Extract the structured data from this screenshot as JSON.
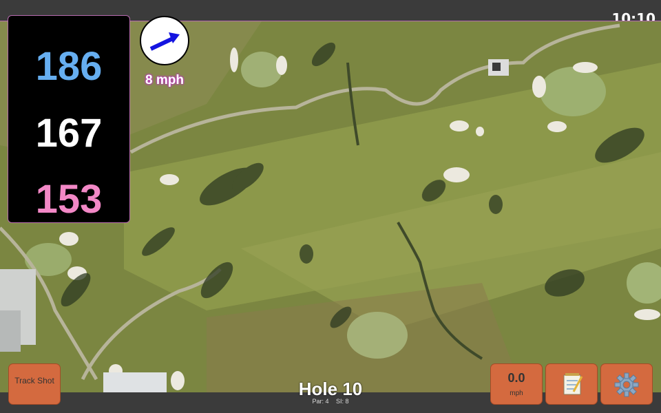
{
  "status_bar": {
    "time": "10:10"
  },
  "distances": {
    "back": "186",
    "middle": "167",
    "front": "153"
  },
  "wind": {
    "speed": "8 mph",
    "icon": "wind-direction-arrow-icon"
  },
  "hole": {
    "title": "Hole 10",
    "par": "Par: 4",
    "si": "SI: 8"
  },
  "buttons": {
    "track_shot": "Track Shot",
    "speed_value": "0.0",
    "speed_unit": "mph",
    "notes_icon": "notepad-icon",
    "settings_icon": "gear-icon"
  },
  "colors": {
    "back_distance": "#66aef0",
    "middle_distance": "#ffffff",
    "front_distance": "#f288c6",
    "button": "#d46a3f",
    "fairway": "#8a9a48"
  }
}
